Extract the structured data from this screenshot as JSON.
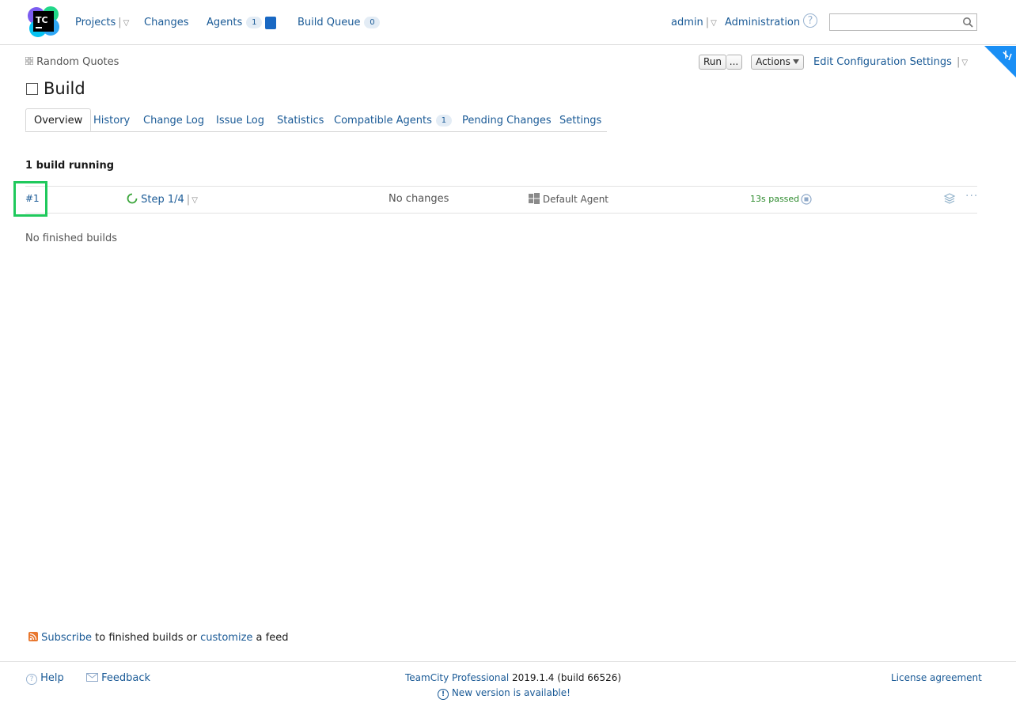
{
  "header": {
    "logo_text": "TC",
    "nav": {
      "projects": "Projects",
      "changes": "Changes",
      "agents": "Agents",
      "agents_count": "1",
      "build_queue": "Build Queue",
      "build_queue_count": "0"
    },
    "user": "admin",
    "administration": "Administration",
    "search_value": ""
  },
  "breadcrumb": {
    "project": "Random Quotes"
  },
  "toolbar": {
    "run_label": "Run",
    "run_more_label": "...",
    "actions_label": "Actions",
    "edit_config_label": "Edit Configuration Settings"
  },
  "page": {
    "title": "Build"
  },
  "tabs": [
    {
      "label": "Overview"
    },
    {
      "label": "History"
    },
    {
      "label": "Change Log"
    },
    {
      "label": "Issue Log"
    },
    {
      "label": "Statistics"
    },
    {
      "label": "Compatible Agents",
      "count": "1"
    },
    {
      "label": "Pending Changes"
    },
    {
      "label": "Settings"
    }
  ],
  "running": {
    "heading": "1 build running",
    "build": {
      "number": "#1",
      "step": "Step 1/4",
      "changes": "No changes",
      "agent": "Default Agent",
      "elapsed": "13s passed"
    }
  },
  "finished": {
    "empty_text": "No finished builds"
  },
  "feed": {
    "subscribe": "Subscribe",
    "middle_text": "to finished builds or",
    "customize": "customize",
    "end_text": "a feed"
  },
  "footer": {
    "help": "Help",
    "feedback": "Feedback",
    "product": "TeamCity Professional",
    "version": "2019.1.4 (build 66526)",
    "new_version": "New version is available!",
    "license": "License agreement"
  },
  "colors": {
    "accent_link": "#1a5a96",
    "success": "#2c8a2c",
    "highlight": "#1fc95c"
  }
}
